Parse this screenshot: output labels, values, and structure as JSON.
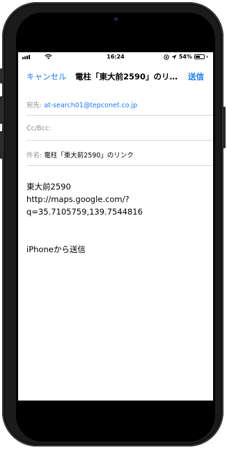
{
  "status": {
    "time": "16:24",
    "battery": "54%",
    "battery_level": 0.54
  },
  "nav": {
    "cancel": "キャンセル",
    "title": "電柱「東大前2590」のリ…",
    "send": "送信"
  },
  "fields": {
    "to_label": "宛先:",
    "to_value": "at-search01@tepconet.co.jp",
    "cc_label": "Cc/Bcc:",
    "subject_label": "件名:",
    "subject_value": "電柱「東大前2590」のリンク"
  },
  "body": {
    "line1": "東大前2590",
    "line2": "http://maps.google.com/?",
    "line3": "q=35.7105759,139.7544816",
    "signature": "iPhoneから送信"
  },
  "colors": {
    "accent": "#1a7cf0",
    "label_gray": "#8e8e93"
  }
}
